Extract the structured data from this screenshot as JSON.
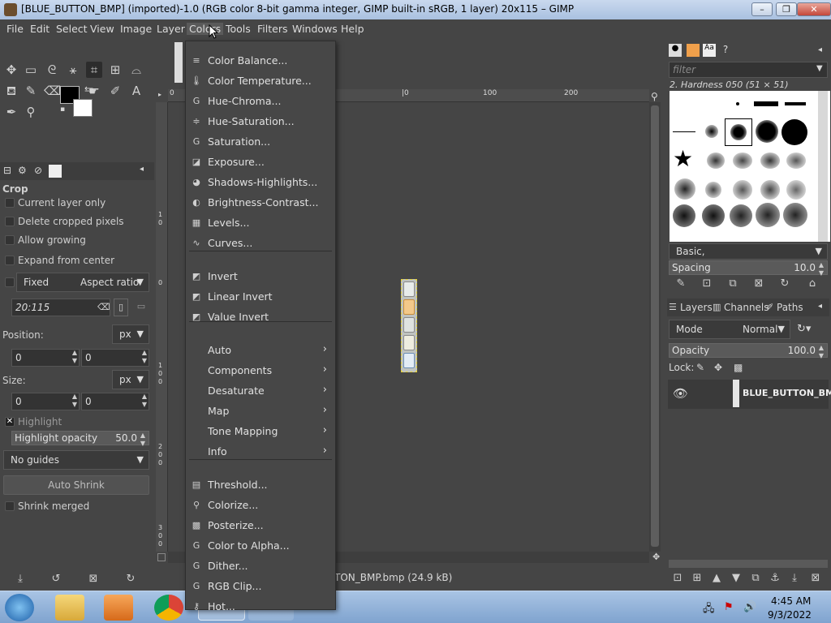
{
  "window": {
    "title": "[BLUE_BUTTON_BMP] (imported)-1.0 (RGB color 8-bit gamma integer, GIMP built-in sRGB, 1 layer) 20x115 – GIMP",
    "minimize": "–",
    "maximize": "❐",
    "close": "✕"
  },
  "menubar": [
    "File",
    "Edit",
    "Select",
    "View",
    "Image",
    "Layer",
    "Colors",
    "Tools",
    "Filters",
    "Windows",
    "Help"
  ],
  "color_menu": {
    "group1": [
      {
        "label": "Color Balance...",
        "icon": "color-balance-icon",
        "glyph": "≡"
      },
      {
        "label": "Color Temperature...",
        "icon": "thermometer-icon",
        "glyph": "🌡"
      },
      {
        "label": "Hue-Chroma...",
        "icon": "gegl-icon",
        "glyph": "G"
      },
      {
        "label": "Hue-Saturation...",
        "icon": "hue-saturation-icon",
        "glyph": "≑"
      },
      {
        "label": "Saturation...",
        "icon": "gegl-icon",
        "glyph": "G"
      },
      {
        "label": "Exposure...",
        "icon": "exposure-icon",
        "glyph": "◪"
      },
      {
        "label": "Shadows-Highlights...",
        "icon": "shadows-highlights-icon",
        "glyph": "◕"
      },
      {
        "label": "Brightness-Contrast...",
        "icon": "brightness-contrast-icon",
        "glyph": "◐"
      },
      {
        "label": "Levels...",
        "icon": "levels-icon",
        "glyph": "▦"
      },
      {
        "label": "Curves...",
        "icon": "curves-icon",
        "glyph": "∿"
      }
    ],
    "group2": [
      {
        "label": "Invert",
        "icon": "invert-icon",
        "glyph": "◩"
      },
      {
        "label": "Linear Invert",
        "icon": "invert-icon",
        "glyph": "◩"
      },
      {
        "label": "Value Invert",
        "icon": "invert-icon",
        "glyph": "◩"
      }
    ],
    "group3": [
      {
        "label": "Auto"
      },
      {
        "label": "Components"
      },
      {
        "label": "Desaturate"
      },
      {
        "label": "Map"
      },
      {
        "label": "Tone Mapping"
      },
      {
        "label": "Info"
      }
    ],
    "group4": [
      {
        "label": "Threshold...",
        "icon": "threshold-icon",
        "glyph": "▤"
      },
      {
        "label": "Colorize...",
        "icon": "colorize-icon",
        "glyph": "⚲"
      },
      {
        "label": "Posterize...",
        "icon": "posterize-icon",
        "glyph": "▩"
      },
      {
        "label": "Color to Alpha...",
        "icon": "gegl-icon",
        "glyph": "G"
      },
      {
        "label": "Dither...",
        "icon": "gegl-icon",
        "glyph": "G"
      },
      {
        "label": "RGB Clip...",
        "icon": "gegl-icon",
        "glyph": "G"
      },
      {
        "label": "Hot...",
        "icon": "plugin-icon",
        "glyph": "⚷"
      }
    ]
  },
  "tool_options": {
    "title": "Crop",
    "current_layer_only": "Current layer only",
    "delete_cropped": "Delete cropped pixels",
    "allow_growing": "Allow growing",
    "expand_center": "Expand from center",
    "fixed": "Fixed",
    "aspect_ratio": "Aspect ratio",
    "ratio_value": "20:115",
    "position_label": "Position:",
    "size_label": "Size:",
    "unit": "px",
    "pos_x": "0",
    "pos_y": "0",
    "size_w": "0",
    "size_h": "0",
    "highlight": "Highlight",
    "highlight_opacity_label": "Highlight opacity",
    "highlight_opacity_value": "50.0",
    "guides": "No guides",
    "auto_shrink": "Auto Shrink",
    "shrink_merged": "Shrink merged"
  },
  "ruler": {
    "top_labels": [
      "0",
      "|0",
      "100",
      "200"
    ],
    "left_labels": [
      "1",
      "0",
      "0",
      "1",
      "0",
      "0",
      "1",
      "5",
      "0",
      "2",
      "0",
      "0",
      "2",
      "5",
      "0",
      "3",
      "0",
      "0"
    ]
  },
  "statusbar": {
    "text": "TON_BMP.bmp (24.9 kB)"
  },
  "brushes": {
    "filter_placeholder": "filter",
    "current": "2. Hardness 050 (51 × 51)",
    "tag": "Basic,",
    "spacing_label": "Spacing",
    "spacing_value": "10.0"
  },
  "layers": {
    "tabs": [
      "Layers",
      "Channels",
      "Paths"
    ],
    "mode_label": "Mode",
    "mode_value": "Normal",
    "opacity_label": "Opacity",
    "opacity_value": "100.0",
    "lock_label": "Lock:",
    "layer_name": "BLUE_BUTTON_BM"
  },
  "taskbar": {
    "time": "4:45 AM",
    "date": "9/3/2022"
  },
  "colors": {
    "fg": "#000000",
    "bg": "#ffffff",
    "selection": "#e6d23a"
  }
}
